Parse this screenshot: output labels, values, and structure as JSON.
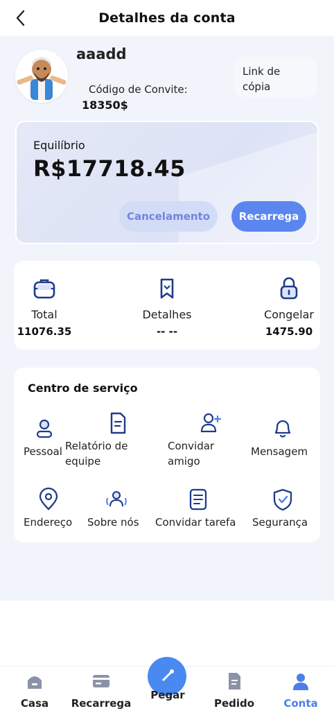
{
  "header": {
    "title": "Detalhes da conta"
  },
  "profile": {
    "username": "aaadd",
    "invite_label": "Código de Convite:",
    "invite_code": "18350$",
    "copy_link": "Link de cópia"
  },
  "balance": {
    "label": "Equilíbrio",
    "amount": "R$17718.45",
    "cancel_label": "Cancelamento",
    "recharge_label": "Recarrega"
  },
  "stats": [
    {
      "label": "Total",
      "value": "11076.35",
      "icon": "briefcase-icon"
    },
    {
      "label": "Detalhes",
      "value": "-- --",
      "icon": "bookmark-icon"
    },
    {
      "label": "Congelar",
      "value": "1475.90",
      "icon": "lock-icon"
    }
  ],
  "services": {
    "title": "Centro de serviço",
    "items": [
      {
        "label": "Pessoal",
        "icon": "person-icon"
      },
      {
        "label": "Relatório de equipe",
        "icon": "document-icon"
      },
      {
        "label": "Convidar amigo",
        "icon": "add-user-icon"
      },
      {
        "label": "Mensagem",
        "icon": "bell-icon"
      },
      {
        "label": "Endereço",
        "icon": "location-icon"
      },
      {
        "label": "Sobre nós",
        "icon": "group-icon"
      },
      {
        "label": "Convidar tarefa",
        "icon": "task-icon"
      },
      {
        "label": "Segurança",
        "icon": "shield-icon"
      }
    ]
  },
  "tabbar": {
    "items": [
      {
        "label": "Casa",
        "icon": "home-icon"
      },
      {
        "label": "Recarrega",
        "icon": "card-icon"
      },
      {
        "label": "Pegar",
        "icon": "grab-icon"
      },
      {
        "label": "Pedido",
        "icon": "order-icon"
      },
      {
        "label": "Conta",
        "icon": "account-icon"
      }
    ],
    "active": "Conta"
  },
  "colors": {
    "accent": "#4a7fe8",
    "button": "#5b86f0",
    "card_bg": "#dde3f6"
  }
}
